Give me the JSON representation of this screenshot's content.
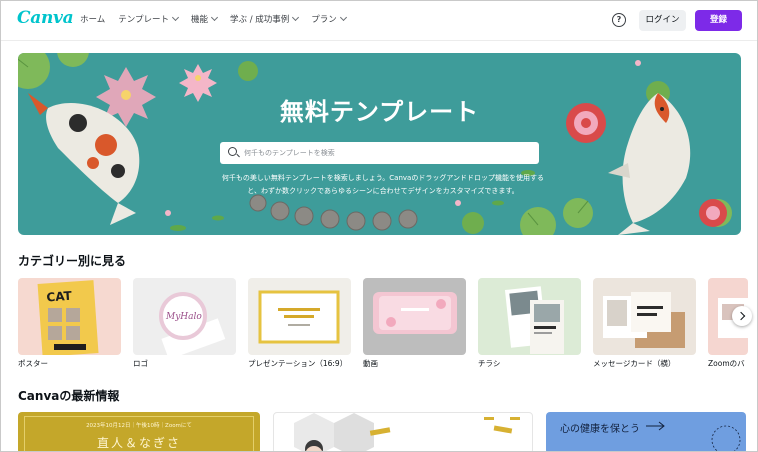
{
  "header": {
    "logo": "Canva",
    "nav": [
      {
        "label": "ホーム",
        "has_menu": false
      },
      {
        "label": "テンプレート",
        "has_menu": true
      },
      {
        "label": "機能",
        "has_menu": true
      },
      {
        "label": "学ぶ / 成功事例",
        "has_menu": true
      },
      {
        "label": "プラン",
        "has_menu": true
      }
    ],
    "help_icon": "question-circle-icon",
    "help_glyph": "?",
    "login": "ログイン",
    "signup": "登録"
  },
  "hero": {
    "title": "無料テンプレート",
    "search_placeholder": "何千ものテンプレートを検索",
    "description": "何千もの美しい無料テンプレートを検索しましょう。Canvaのドラッグアンドドロップ機能を使用すると、わずか数クリックであらゆるシーンに合わせてデザインをカスタマイズできます。",
    "background": "#3e9c9a"
  },
  "categories": {
    "title": "カテゴリー別に見る",
    "items": [
      {
        "label": "ポスター",
        "bg": "#f6d9d0"
      },
      {
        "label": "ロゴ",
        "bg": "#eeeeee"
      },
      {
        "label": "プレゼンテーション（16:9）",
        "bg": "#f0eee9"
      },
      {
        "label": "動画",
        "bg": "#bdbdbd"
      },
      {
        "label": "チラシ",
        "bg": "#dcebd6"
      },
      {
        "label": "メッセージカード（横）",
        "bg": "#ece5dd"
      },
      {
        "label": "Zoomのバ",
        "bg": "#f5d6d0"
      }
    ],
    "next_icon": "chevron-right-icon"
  },
  "news": {
    "title": "Canvaの最新情報",
    "card1_date": "2023年10月12日｜午後10時｜Zoomにて",
    "card1_title": "直人＆なぎさ",
    "card3_title": "心の健康を保とう"
  }
}
